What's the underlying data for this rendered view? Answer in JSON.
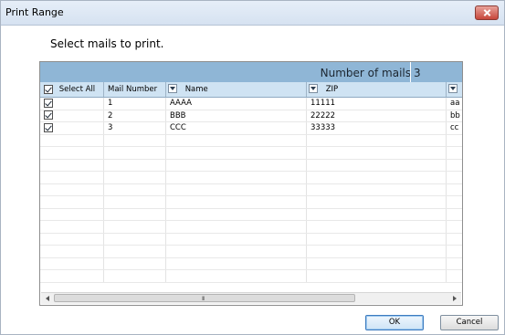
{
  "window": {
    "title": "Print Range"
  },
  "heading": "Select mails to print.",
  "grid": {
    "count_label": "Number of mails",
    "count_value": "3",
    "columns": {
      "select_all": "Select All",
      "mail_number": "Mail Number",
      "name": "Name",
      "zip": "ZIP"
    },
    "rows": [
      {
        "checked": true,
        "mail_number": "1",
        "name": "AAAA",
        "zip": "11111",
        "next": "aa"
      },
      {
        "checked": true,
        "mail_number": "2",
        "name": "BBB",
        "zip": "22222",
        "next": "bb"
      },
      {
        "checked": true,
        "mail_number": "3",
        "name": "CCC",
        "zip": "33333",
        "next": "cc"
      }
    ],
    "scroll_grip": "III"
  },
  "buttons": {
    "ok": "OK",
    "cancel": "Cancel"
  },
  "colors": {
    "grid_header": "#8fb6d6",
    "column_header": "#cfe3f3",
    "primary_button": "#3d7bbf"
  }
}
